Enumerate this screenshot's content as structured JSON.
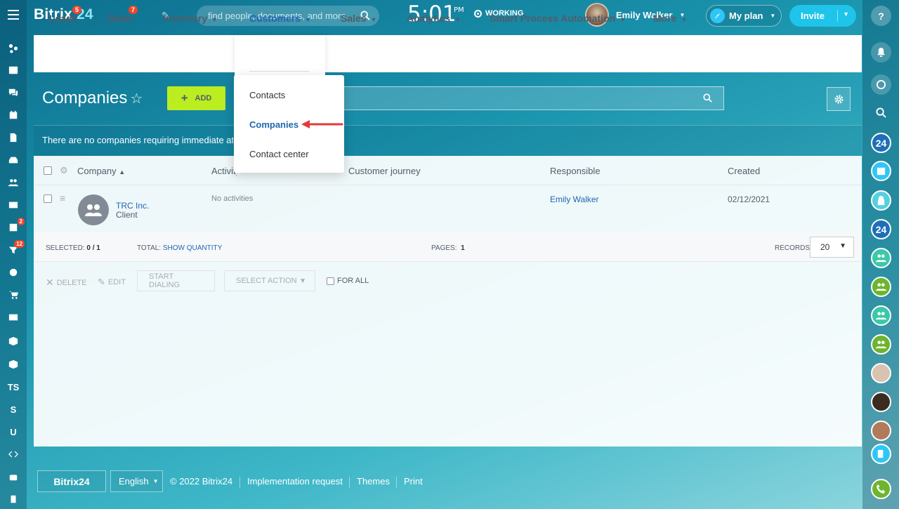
{
  "header": {
    "logo_text": "Bitrix",
    "logo_num": "24",
    "search_placeholder": "find people, documents, and more",
    "clock": "5:01",
    "clock_ampm": "PM",
    "status": "WORKING",
    "user_name": "Emily Walker",
    "plan_label": "My plan",
    "invite_label": "Invite"
  },
  "left_bar": {
    "badges": {
      "tasks": "2",
      "crm": "12"
    },
    "text_items": [
      "TS",
      "S",
      "U"
    ]
  },
  "right_bar": {
    "b24": "24"
  },
  "menu": {
    "items": [
      {
        "label": "Leads",
        "badge": "5"
      },
      {
        "label": "Deals",
        "badge": "7"
      },
      {
        "label": "Inventory"
      },
      {
        "label": "Customers"
      },
      {
        "label": "Sales"
      },
      {
        "label": "Analytics"
      },
      {
        "label": "Smart Process Automation"
      },
      {
        "label": "More"
      }
    ],
    "dropdown": [
      "Contacts",
      "Companies",
      "Contact center"
    ]
  },
  "page": {
    "title": "Companies",
    "add_label": "ADD",
    "notice": "There are no companies requiring immediate attention"
  },
  "grid": {
    "columns": [
      "Company",
      "Activity",
      "Customer journey",
      "Responsible",
      "Created"
    ],
    "rows": [
      {
        "company": "TRC Inc.",
        "type": "Client",
        "activity": "No activities",
        "responsible": "Emily Walker",
        "created": "02/12/2021"
      }
    ],
    "footer": {
      "selected_label": "SELECTED:",
      "selected_value": "0 / 1",
      "total_label": "TOTAL:",
      "total_link": "SHOW QUANTITY",
      "pages_label": "PAGES:",
      "pages_value": "1",
      "records_label": "RECORDS:",
      "records_value": "20"
    },
    "actions": {
      "delete": "DELETE",
      "edit": "EDIT",
      "start_dialing": "START DIALING",
      "select_action": "SELECT ACTION",
      "for_all": "FOR ALL"
    }
  },
  "footer": {
    "logo": "Bitrix24",
    "language": "English",
    "copyright": "© 2022 Bitrix24",
    "links": [
      "Implementation request",
      "Themes",
      "Print"
    ]
  },
  "colors": {
    "accent_blue": "#2067b0",
    "add_green": "#bbed21",
    "badge_red": "#f0462c",
    "invite_cyan": "#1ec4ea"
  }
}
